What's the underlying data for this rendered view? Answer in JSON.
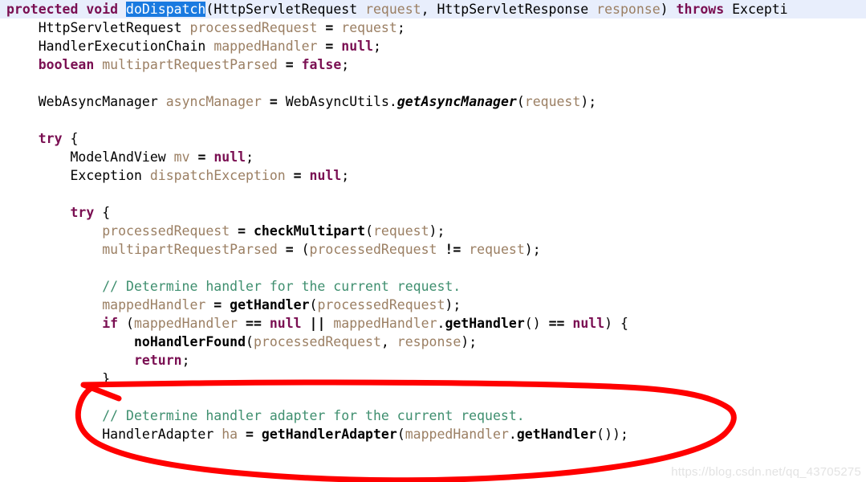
{
  "editor": {
    "language": "java",
    "selected_token": "doDispatch",
    "selection_color": "#1a7ae0",
    "current_line_highlight_color": "#e8eefc",
    "keyword_color": "#7a0f52",
    "comment_color": "#3f8f6f",
    "variable_color": "#9b7f63",
    "text_color": "#000000",
    "annotation_color": "#ff0000"
  },
  "code": {
    "lines": [
      {
        "n": 1,
        "current": true,
        "tokens": [
          {
            "t": "kw",
            "s": "protected"
          },
          {
            "t": "punct",
            "s": " "
          },
          {
            "t": "kw",
            "s": "void"
          },
          {
            "t": "punct",
            "s": " "
          },
          {
            "t": "sel",
            "s": "doDispatch"
          },
          {
            "t": "punct",
            "s": "("
          },
          {
            "t": "type",
            "s": "HttpServletRequest"
          },
          {
            "t": "punct",
            "s": " "
          },
          {
            "t": "var",
            "s": "request"
          },
          {
            "t": "punct",
            "s": ", "
          },
          {
            "t": "type",
            "s": "HttpServletResponse"
          },
          {
            "t": "punct",
            "s": " "
          },
          {
            "t": "var",
            "s": "response"
          },
          {
            "t": "punct",
            "s": ") "
          },
          {
            "t": "kw",
            "s": "throws"
          },
          {
            "t": "punct",
            "s": " "
          },
          {
            "t": "type",
            "s": "Excepti"
          }
        ]
      },
      {
        "n": 2,
        "current": false,
        "tokens": [
          {
            "t": "punct",
            "s": "    "
          },
          {
            "t": "type",
            "s": "HttpServletRequest"
          },
          {
            "t": "punct",
            "s": " "
          },
          {
            "t": "var",
            "s": "processedRequest"
          },
          {
            "t": "punct",
            "s": " "
          },
          {
            "t": "op",
            "s": "="
          },
          {
            "t": "punct",
            "s": " "
          },
          {
            "t": "var",
            "s": "request"
          },
          {
            "t": "punct",
            "s": ";"
          }
        ]
      },
      {
        "n": 3,
        "current": false,
        "tokens": [
          {
            "t": "punct",
            "s": "    "
          },
          {
            "t": "type",
            "s": "HandlerExecutionChain"
          },
          {
            "t": "punct",
            "s": " "
          },
          {
            "t": "var",
            "s": "mappedHandler"
          },
          {
            "t": "punct",
            "s": " "
          },
          {
            "t": "op",
            "s": "="
          },
          {
            "t": "punct",
            "s": " "
          },
          {
            "t": "kw",
            "s": "null"
          },
          {
            "t": "punct",
            "s": ";"
          }
        ]
      },
      {
        "n": 4,
        "current": false,
        "tokens": [
          {
            "t": "punct",
            "s": "    "
          },
          {
            "t": "kw",
            "s": "boolean"
          },
          {
            "t": "punct",
            "s": " "
          },
          {
            "t": "var",
            "s": "multipartRequestParsed"
          },
          {
            "t": "punct",
            "s": " "
          },
          {
            "t": "op",
            "s": "="
          },
          {
            "t": "punct",
            "s": " "
          },
          {
            "t": "kw",
            "s": "false"
          },
          {
            "t": "punct",
            "s": ";"
          }
        ]
      },
      {
        "n": 5,
        "current": false,
        "tokens": []
      },
      {
        "n": 6,
        "current": false,
        "tokens": [
          {
            "t": "punct",
            "s": "    "
          },
          {
            "t": "type",
            "s": "WebAsyncManager"
          },
          {
            "t": "punct",
            "s": " "
          },
          {
            "t": "var",
            "s": "asyncManager"
          },
          {
            "t": "punct",
            "s": " "
          },
          {
            "t": "op",
            "s": "="
          },
          {
            "t": "punct",
            "s": " "
          },
          {
            "t": "type",
            "s": "WebAsyncUtils"
          },
          {
            "t": "punct",
            "s": "."
          },
          {
            "t": "methodi",
            "s": "getAsyncManager"
          },
          {
            "t": "punct",
            "s": "("
          },
          {
            "t": "var",
            "s": "request"
          },
          {
            "t": "punct",
            "s": ");"
          }
        ]
      },
      {
        "n": 7,
        "current": false,
        "tokens": []
      },
      {
        "n": 8,
        "current": false,
        "tokens": [
          {
            "t": "punct",
            "s": "    "
          },
          {
            "t": "kw",
            "s": "try"
          },
          {
            "t": "punct",
            "s": " {"
          }
        ]
      },
      {
        "n": 9,
        "current": false,
        "tokens": [
          {
            "t": "punct",
            "s": "        "
          },
          {
            "t": "type",
            "s": "ModelAndView"
          },
          {
            "t": "punct",
            "s": " "
          },
          {
            "t": "var",
            "s": "mv"
          },
          {
            "t": "punct",
            "s": " "
          },
          {
            "t": "op",
            "s": "="
          },
          {
            "t": "punct",
            "s": " "
          },
          {
            "t": "kw",
            "s": "null"
          },
          {
            "t": "punct",
            "s": ";"
          }
        ]
      },
      {
        "n": 10,
        "current": false,
        "tokens": [
          {
            "t": "punct",
            "s": "        "
          },
          {
            "t": "type",
            "s": "Exception"
          },
          {
            "t": "punct",
            "s": " "
          },
          {
            "t": "var",
            "s": "dispatchException"
          },
          {
            "t": "punct",
            "s": " "
          },
          {
            "t": "op",
            "s": "="
          },
          {
            "t": "punct",
            "s": " "
          },
          {
            "t": "kw",
            "s": "null"
          },
          {
            "t": "punct",
            "s": ";"
          }
        ]
      },
      {
        "n": 11,
        "current": false,
        "tokens": []
      },
      {
        "n": 12,
        "current": false,
        "tokens": [
          {
            "t": "punct",
            "s": "        "
          },
          {
            "t": "kw",
            "s": "try"
          },
          {
            "t": "punct",
            "s": " {"
          }
        ]
      },
      {
        "n": 13,
        "current": false,
        "tokens": [
          {
            "t": "punct",
            "s": "            "
          },
          {
            "t": "var",
            "s": "processedRequest"
          },
          {
            "t": "punct",
            "s": " "
          },
          {
            "t": "op",
            "s": "="
          },
          {
            "t": "punct",
            "s": " "
          },
          {
            "t": "method",
            "s": "checkMultipart"
          },
          {
            "t": "punct",
            "s": "("
          },
          {
            "t": "var",
            "s": "request"
          },
          {
            "t": "punct",
            "s": ");"
          }
        ]
      },
      {
        "n": 14,
        "current": false,
        "tokens": [
          {
            "t": "punct",
            "s": "            "
          },
          {
            "t": "var",
            "s": "multipartRequestParsed"
          },
          {
            "t": "punct",
            "s": " "
          },
          {
            "t": "op",
            "s": "="
          },
          {
            "t": "punct",
            "s": " ("
          },
          {
            "t": "var",
            "s": "processedRequest"
          },
          {
            "t": "punct",
            "s": " "
          },
          {
            "t": "op",
            "s": "!="
          },
          {
            "t": "punct",
            "s": " "
          },
          {
            "t": "var",
            "s": "request"
          },
          {
            "t": "punct",
            "s": ");"
          }
        ]
      },
      {
        "n": 15,
        "current": false,
        "tokens": []
      },
      {
        "n": 16,
        "current": false,
        "tokens": [
          {
            "t": "punct",
            "s": "            "
          },
          {
            "t": "comment",
            "s": "// Determine handler for the current request."
          }
        ]
      },
      {
        "n": 17,
        "current": false,
        "tokens": [
          {
            "t": "punct",
            "s": "            "
          },
          {
            "t": "var",
            "s": "mappedHandler"
          },
          {
            "t": "punct",
            "s": " "
          },
          {
            "t": "op",
            "s": "="
          },
          {
            "t": "punct",
            "s": " "
          },
          {
            "t": "method",
            "s": "getHandler"
          },
          {
            "t": "punct",
            "s": "("
          },
          {
            "t": "var",
            "s": "processedRequest"
          },
          {
            "t": "punct",
            "s": ");"
          }
        ]
      },
      {
        "n": 18,
        "current": false,
        "tokens": [
          {
            "t": "punct",
            "s": "            "
          },
          {
            "t": "kw",
            "s": "if"
          },
          {
            "t": "punct",
            "s": " ("
          },
          {
            "t": "var",
            "s": "mappedHandler"
          },
          {
            "t": "punct",
            "s": " "
          },
          {
            "t": "op",
            "s": "=="
          },
          {
            "t": "punct",
            "s": " "
          },
          {
            "t": "kw",
            "s": "null"
          },
          {
            "t": "punct",
            "s": " "
          },
          {
            "t": "op",
            "s": "||"
          },
          {
            "t": "punct",
            "s": " "
          },
          {
            "t": "var",
            "s": "mappedHandler"
          },
          {
            "t": "punct",
            "s": "."
          },
          {
            "t": "method",
            "s": "getHandler"
          },
          {
            "t": "punct",
            "s": "() "
          },
          {
            "t": "op",
            "s": "=="
          },
          {
            "t": "punct",
            "s": " "
          },
          {
            "t": "kw",
            "s": "null"
          },
          {
            "t": "punct",
            "s": ") {"
          }
        ]
      },
      {
        "n": 19,
        "current": false,
        "tokens": [
          {
            "t": "punct",
            "s": "                "
          },
          {
            "t": "method",
            "s": "noHandlerFound"
          },
          {
            "t": "punct",
            "s": "("
          },
          {
            "t": "var",
            "s": "processedRequest"
          },
          {
            "t": "punct",
            "s": ", "
          },
          {
            "t": "var",
            "s": "response"
          },
          {
            "t": "punct",
            "s": ");"
          }
        ]
      },
      {
        "n": 20,
        "current": false,
        "tokens": [
          {
            "t": "punct",
            "s": "                "
          },
          {
            "t": "kw",
            "s": "return"
          },
          {
            "t": "punct",
            "s": ";"
          }
        ]
      },
      {
        "n": 21,
        "current": false,
        "tokens": [
          {
            "t": "punct",
            "s": "            }"
          }
        ]
      },
      {
        "n": 22,
        "current": false,
        "tokens": []
      },
      {
        "n": 23,
        "current": false,
        "tokens": [
          {
            "t": "punct",
            "s": "            "
          },
          {
            "t": "comment",
            "s": "// Determine handler adapter for the current request."
          }
        ]
      },
      {
        "n": 24,
        "current": false,
        "tokens": [
          {
            "t": "punct",
            "s": "            "
          },
          {
            "t": "type",
            "s": "HandlerAdapter"
          },
          {
            "t": "punct",
            "s": " "
          },
          {
            "t": "var",
            "s": "ha"
          },
          {
            "t": "punct",
            "s": " "
          },
          {
            "t": "op",
            "s": "="
          },
          {
            "t": "punct",
            "s": " "
          },
          {
            "t": "method",
            "s": "getHandlerAdapter"
          },
          {
            "t": "punct",
            "s": "("
          },
          {
            "t": "var",
            "s": "mappedHandler"
          },
          {
            "t": "punct",
            "s": "."
          },
          {
            "t": "method",
            "s": "getHandler"
          },
          {
            "t": "punct",
            "s": "());"
          }
        ]
      }
    ]
  },
  "annotation": {
    "shape": "hand-drawn-ellipse",
    "color": "#ff0000",
    "stroke_width": 7
  },
  "watermark": {
    "text": "https://blog.csdn.net/qq_43705275",
    "color": "#e3e3e3"
  }
}
